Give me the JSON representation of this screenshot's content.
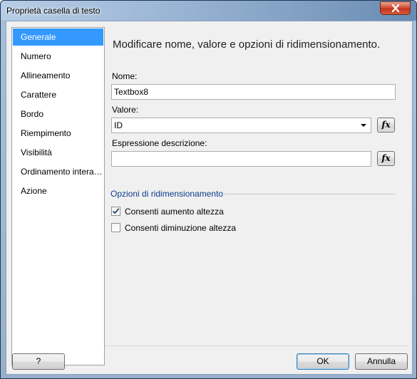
{
  "window": {
    "title": "Proprietà casella di testo"
  },
  "sidebar": {
    "items": [
      {
        "label": "Generale",
        "selected": true
      },
      {
        "label": "Numero"
      },
      {
        "label": "Allineamento"
      },
      {
        "label": "Carattere"
      },
      {
        "label": "Bordo"
      },
      {
        "label": "Riempimento"
      },
      {
        "label": "Visibilità"
      },
      {
        "label": "Ordinamento interattivo"
      },
      {
        "label": "Azione"
      }
    ]
  },
  "main": {
    "heading": "Modificare nome, valore e opzioni di ridimensionamento.",
    "name_label": "Nome:",
    "name_value": "Textbox8",
    "value_label": "Valore:",
    "value_value": "ID",
    "tooltip_label": "Espressione descrizione:",
    "tooltip_value": "",
    "fx_label": "fx",
    "resize_section_title": "Opzioni di ridimensionamento",
    "options": [
      {
        "label": "Consenti aumento altezza",
        "checked": true
      },
      {
        "label": "Consenti diminuzione altezza",
        "checked": false
      }
    ]
  },
  "footer": {
    "help_label": "?",
    "ok_label": "OK",
    "cancel_label": "Annulla"
  },
  "colors": {
    "selection": "#3399ff",
    "section_title": "#0b3b8c"
  },
  "icons": {
    "close": "close-icon",
    "dropdown": "chevron-down-icon",
    "check": "check-icon"
  }
}
